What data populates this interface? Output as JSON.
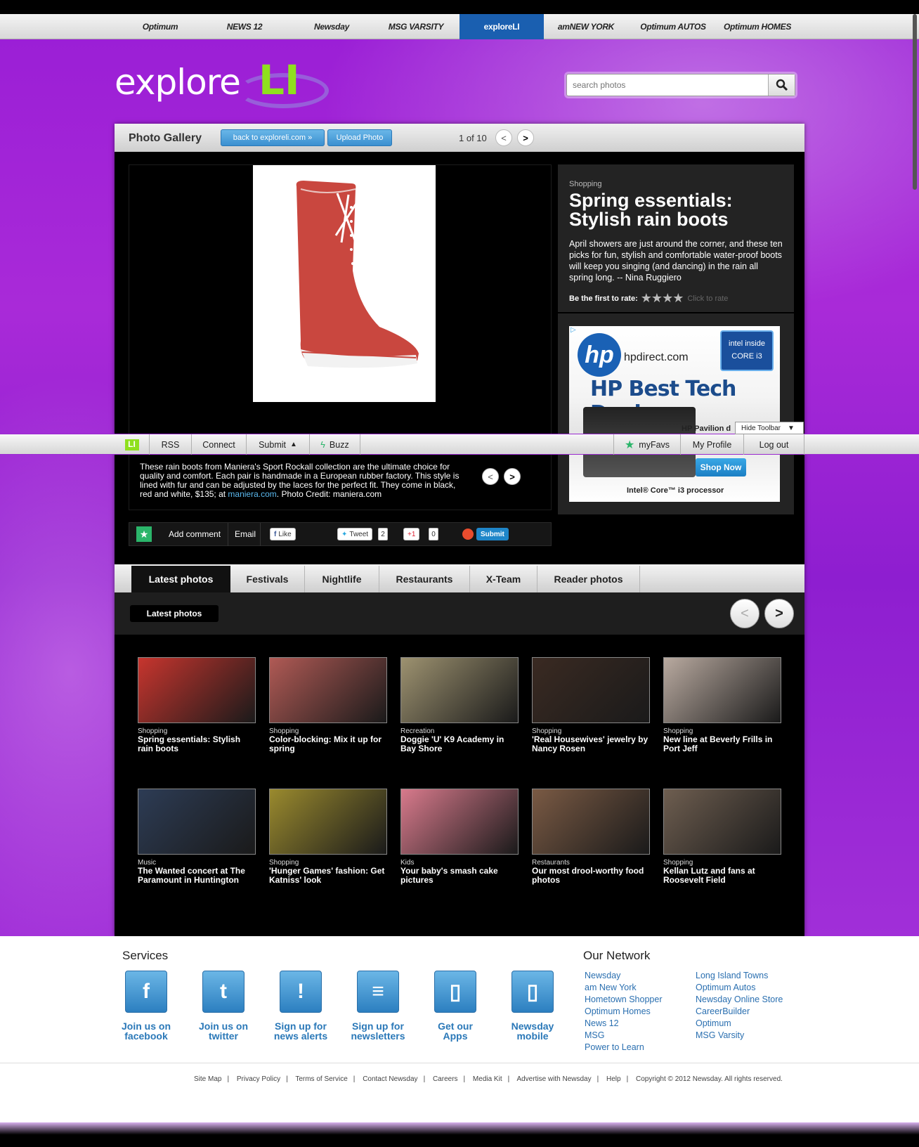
{
  "network": {
    "items": [
      {
        "label": "Optimum"
      },
      {
        "label": "NEWS 12"
      },
      {
        "label": "Newsday"
      },
      {
        "label": "MSG VARSITY"
      },
      {
        "label": "exploreLI"
      },
      {
        "label": "amNEW YORK"
      },
      {
        "label": "Optimum AUTOS"
      },
      {
        "label": "Optimum HOMES"
      }
    ],
    "active_index": 4
  },
  "logo": {
    "text_main": "explore",
    "text_accent": "LI"
  },
  "search": {
    "placeholder": "search photos"
  },
  "gallery": {
    "title": "Photo Gallery",
    "back_label": "back to exploreli.com »",
    "upload_label": "Upload Photo",
    "counter": "1 of 10"
  },
  "info": {
    "category": "Shopping",
    "title": "Spring essentials: Stylish rain boots",
    "description": "April showers are just around the corner, and these ten picks for fun, stylish and comfortable water-proof boots will keep you singing (and dancing) in the rain all spring long. -- Nina Ruggiero",
    "rate_label": "Be the first to rate:",
    "rate_hint": "Click to rate",
    "stars": 4
  },
  "ad": {
    "domain": "hpdirect.com",
    "intel": "intel inside CORE i3",
    "headline": "HP Best Tech Deals",
    "product": "HP Pavilion d",
    "cta": "Shop Now",
    "footer": "Intel® Core™ i3 processor"
  },
  "caption": {
    "text": "These rain boots from Maniera's Sport Rockall collection are the ultimate choice for quality and comfort. Each pair is handmade in a European rubber factory. This style is lined with fur and can be adjusted by the laces for the perfect fit. They come in black, red and white, $135; at ",
    "link": "maniera.com",
    "credit": ". Photo Credit: maniera.com"
  },
  "share": {
    "add_comment": "Add comment",
    "email": "Email",
    "like": "Like",
    "tweet": "Tweet",
    "tweet_count": "2",
    "plusone": "+1",
    "plusone_count": "0",
    "submit": "Submit"
  },
  "toolbar": {
    "rss": "RSS",
    "connect": "Connect",
    "submit": "Submit",
    "buzz": "Buzz",
    "myfavs": "myFavs",
    "profile": "My Profile",
    "logout": "Log out",
    "hide": "Hide Toolbar"
  },
  "tabs": [
    "Latest photos",
    "Festivals",
    "Nightlife",
    "Restaurants",
    "X-Team",
    "Reader photos"
  ],
  "section_label": "Latest photos",
  "thumbs": [
    {
      "cat": "Shopping",
      "title": "Spring essentials: Stylish rain boots",
      "color": "#c7352e"
    },
    {
      "cat": "Shopping",
      "title": "Color-blocking: Mix it up for spring",
      "color": "#b05a55"
    },
    {
      "cat": "Recreation",
      "title": "Doggie 'U' K9 Academy in Bay Shore",
      "color": "#9d9270"
    },
    {
      "cat": "Shopping",
      "title": "'Real Housewives' jewelry by Nancy Rosen",
      "color": "#3a2a22"
    },
    {
      "cat": "Shopping",
      "title": "New line at Beverly Frills in Port Jeff",
      "color": "#b9aaa0"
    },
    {
      "cat": "Music",
      "title": "The Wanted concert at The Paramount in Huntington",
      "color": "#2d3c55"
    },
    {
      "cat": "Shopping",
      "title": "'Hunger Games' fashion: Get Katniss' look",
      "color": "#9a8a2e"
    },
    {
      "cat": "Kids",
      "title": "Your baby's smash cake pictures",
      "color": "#d87a8c"
    },
    {
      "cat": "Restaurants",
      "title": "Our most drool-worthy food photos",
      "color": "#7a5a44"
    },
    {
      "cat": "Shopping",
      "title": "Kellan Lutz and fans at Roosevelt Field",
      "color": "#6e5e50"
    }
  ],
  "footer": {
    "services_title": "Services",
    "services": [
      {
        "l1": "Join us on",
        "l2": "facebook",
        "icon": "facebook-icon",
        "glyph": "f"
      },
      {
        "l1": "Join us on",
        "l2": "twitter",
        "icon": "twitter-icon",
        "glyph": "t"
      },
      {
        "l1": "Sign up for",
        "l2": "news alerts",
        "icon": "alert-icon",
        "glyph": "!"
      },
      {
        "l1": "Sign up for",
        "l2": "newsletters",
        "icon": "newsletter-icon",
        "glyph": "≡"
      },
      {
        "l1": "Get our",
        "l2": "Apps",
        "icon": "apps-icon",
        "glyph": "▯"
      },
      {
        "l1": "Newsday",
        "l2": "mobile",
        "icon": "mobile-icon",
        "glyph": "▯"
      }
    ],
    "network_title": "Our Network",
    "network_col1": [
      "Newsday",
      "am New York",
      "Hometown Shopper",
      "Optimum Homes",
      "News 12",
      "MSG",
      "Power to Learn"
    ],
    "network_col2": [
      "Long Island Towns",
      "Optimum Autos",
      "Newsday Online Store",
      "CareerBuilder",
      "Optimum",
      "MSG Varsity"
    ],
    "links": [
      "Site Map",
      "Privacy Policy",
      "Terms of Service",
      "Contact Newsday",
      "Careers",
      "Media Kit",
      "Advertise with Newsday",
      "Help"
    ],
    "copyright": "Copyright © 2012 Newsday. All rights reserved."
  }
}
